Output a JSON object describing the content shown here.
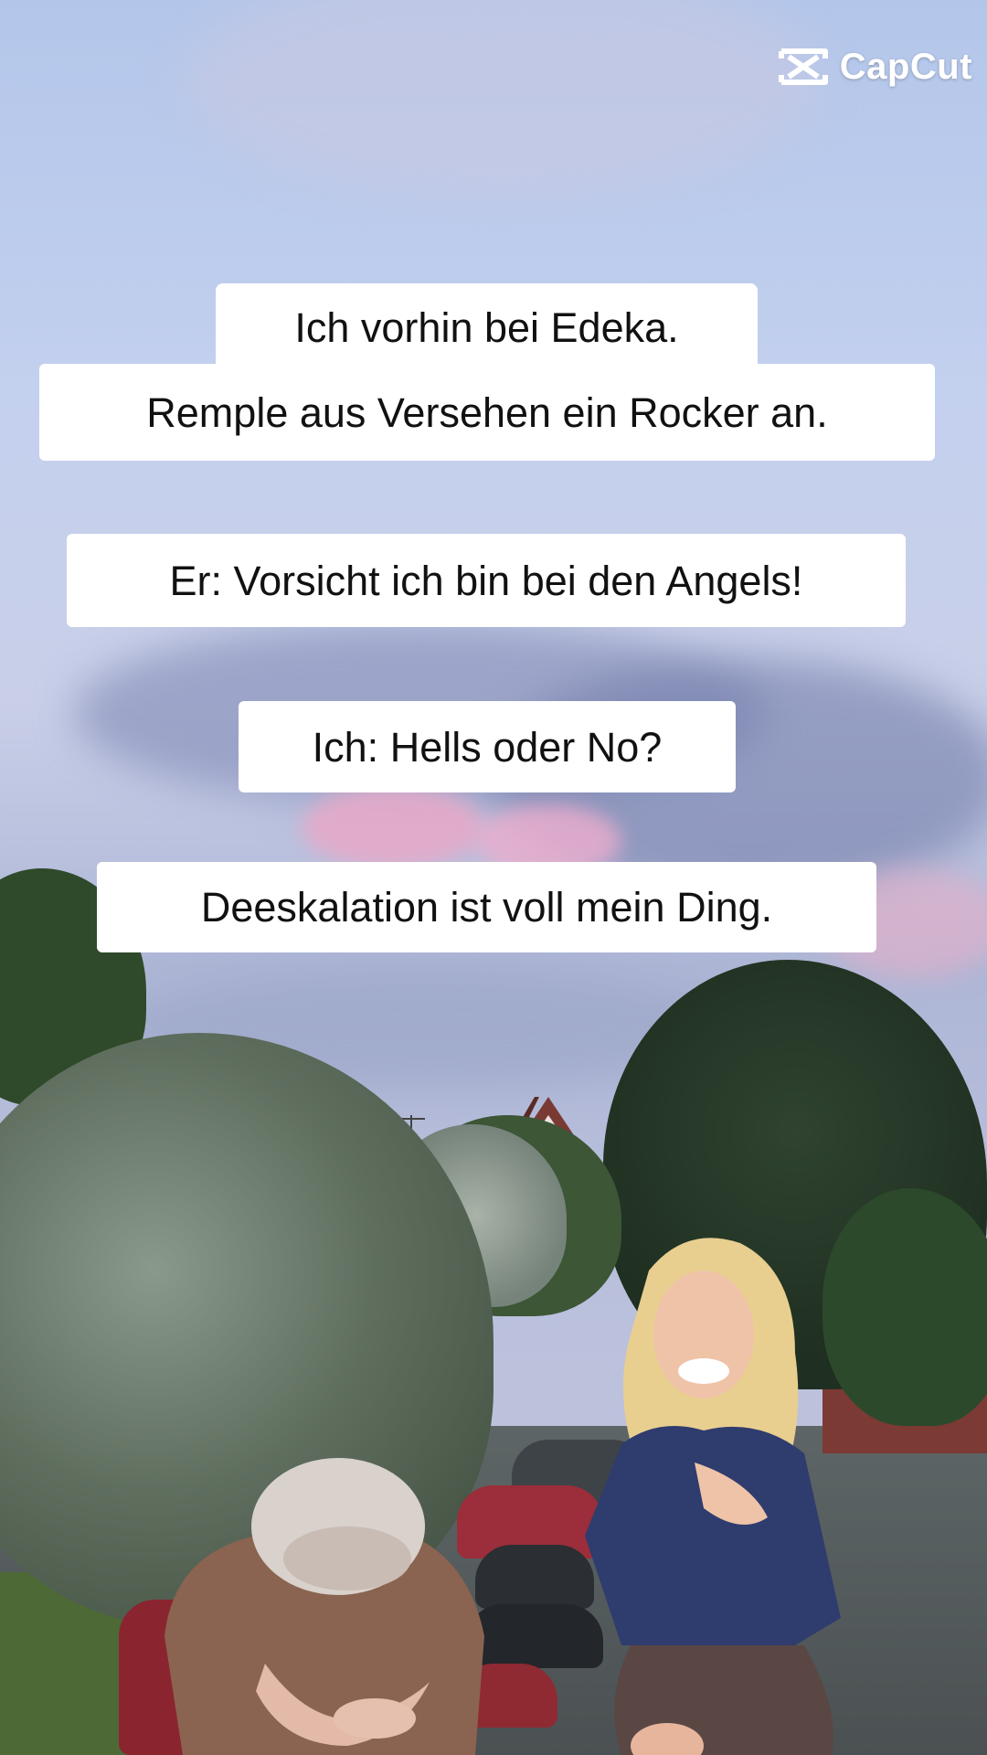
{
  "watermark": {
    "icon": "capcut-logo-icon",
    "text": "CapCut"
  },
  "captions": [
    "Ich vorhin bei Edeka.",
    "Remple aus Versehen ein Rocker an.",
    "Er: Vorsicht ich bin bei den Angels!",
    "Ich: Hells oder No?",
    "Deeskalation ist voll mein Ding."
  ],
  "colors": {
    "caption_background": "#ffffff",
    "caption_text": "#111111",
    "watermark_text": "#ffffff"
  }
}
